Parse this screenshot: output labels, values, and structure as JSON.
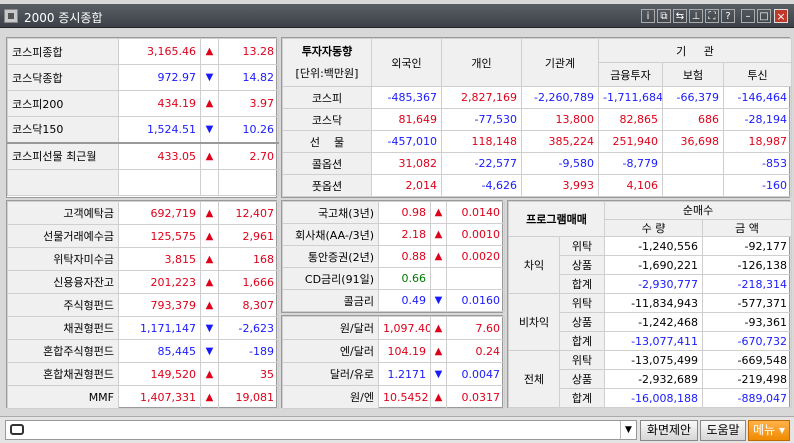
{
  "window": {
    "title": "2000 증시종합"
  },
  "index": [
    {
      "name": "코스피종합",
      "value": "3,165.46",
      "dir": "up",
      "change": "13.28"
    },
    {
      "name": "코스닥종합",
      "value": "972.97",
      "dir": "down",
      "change": "14.82"
    },
    {
      "name": "코스피200",
      "value": "434.19",
      "dir": "up",
      "change": "3.97"
    },
    {
      "name": "코스닥150",
      "value": "1,524.51",
      "dir": "down",
      "change": "10.26"
    }
  ],
  "futures": {
    "name": "코스피선물 최근월",
    "value": "433.05",
    "dir": "up",
    "change": "2.70"
  },
  "investor": {
    "title": "투자자동향",
    "unit": "[단위:백만원]",
    "cols": [
      "외국인",
      "개인",
      "기관계"
    ],
    "inst_title": "기     관",
    "inst_cols": [
      "금융투자",
      "보험",
      "투신"
    ],
    "rows": [
      {
        "label": "코스피",
        "vals": [
          "-485,367",
          "2,827,169",
          "-2,260,789",
          "-1,711,684",
          "-66,379",
          "-146,464"
        ]
      },
      {
        "label": "코스닥",
        "vals": [
          "81,649",
          "-77,530",
          "13,800",
          "82,865",
          "686",
          "-28,194"
        ]
      },
      {
        "label": "선    물",
        "vals": [
          "-457,010",
          "118,148",
          "385,224",
          "251,940",
          "36,698",
          "18,987"
        ]
      },
      {
        "label": "콜옵션",
        "vals": [
          "31,082",
          "-22,577",
          "-9,580",
          "-8,779",
          "",
          "-853"
        ]
      },
      {
        "label": "풋옵션",
        "vals": [
          "2,014",
          "-4,626",
          "3,993",
          "4,106",
          "",
          "-160"
        ]
      }
    ]
  },
  "funds": [
    {
      "name": "고객예탁금",
      "value": "692,719",
      "dir": "up",
      "change": "12,407"
    },
    {
      "name": "선물거래예수금",
      "value": "125,575",
      "dir": "up",
      "change": "2,961"
    },
    {
      "name": "위탁자미수금",
      "value": "3,815",
      "dir": "up",
      "change": "168"
    },
    {
      "name": "신용융자잔고",
      "value": "201,223",
      "dir": "up",
      "change": "1,666"
    },
    {
      "name": "주식형펀드",
      "value": "793,379",
      "dir": "up",
      "change": "8,307"
    },
    {
      "name": "채권형펀드",
      "value": "1,171,147",
      "dir": "down",
      "change": "-2,623"
    },
    {
      "name": "혼합주식형펀드",
      "value": "85,445",
      "dir": "down",
      "change": "-189"
    },
    {
      "name": "혼합채권형펀드",
      "value": "149,520",
      "dir": "up",
      "change": "35"
    },
    {
      "name": "MMF",
      "value": "1,407,331",
      "dir": "up",
      "change": "19,081"
    }
  ],
  "rates": [
    {
      "name": "국고채(3년)",
      "value": "0.98",
      "color": "red",
      "dir": "up",
      "change": "0.0140"
    },
    {
      "name": "회사채(AA-/3년)",
      "value": "2.18",
      "color": "red",
      "dir": "up",
      "change": "0.0010"
    },
    {
      "name": "통안증권(2년)",
      "value": "0.88",
      "color": "red",
      "dir": "up",
      "change": "0.0020"
    },
    {
      "name": "CD금리(91일)",
      "value": "0.66",
      "color": "green",
      "dir": "",
      "change": ""
    },
    {
      "name": "콜금리",
      "value": "0.49",
      "color": "blue",
      "dir": "down",
      "change": "0.0160"
    }
  ],
  "fx": [
    {
      "name": "원/달러",
      "value": "1,097.40",
      "color": "red",
      "dir": "up",
      "change": "7.60"
    },
    {
      "name": "엔/달러",
      "value": "104.19",
      "color": "red",
      "dir": "up",
      "change": "0.24"
    },
    {
      "name": "달러/유로",
      "value": "1.2171",
      "color": "blue",
      "dir": "down",
      "change": "0.0047"
    },
    {
      "name": "원/엔",
      "value": "10.5452",
      "color": "red",
      "dir": "up",
      "change": "0.0317"
    }
  ],
  "program": {
    "title": "프로그램매매",
    "net_title": "순매수",
    "qty_label": "수  량",
    "amt_label": "금  액",
    "groups": [
      {
        "name": "차익",
        "rows": [
          {
            "type": "위탁",
            "qty": "-1,240,556",
            "amt": "-92,177",
            "color": "black"
          },
          {
            "type": "상품",
            "qty": "-1,690,221",
            "amt": "-126,138",
            "color": "black"
          },
          {
            "type": "합계",
            "qty": "-2,930,777",
            "amt": "-218,314",
            "color": "blue"
          }
        ]
      },
      {
        "name": "비차익",
        "rows": [
          {
            "type": "위탁",
            "qty": "-11,834,943",
            "amt": "-577,371",
            "color": "black"
          },
          {
            "type": "상품",
            "qty": "-1,242,468",
            "amt": "-93,361",
            "color": "black"
          },
          {
            "type": "합계",
            "qty": "-13,077,411",
            "amt": "-670,732",
            "color": "blue"
          }
        ]
      },
      {
        "name": "전체",
        "rows": [
          {
            "type": "위탁",
            "qty": "-13,075,499",
            "amt": "-669,548",
            "color": "black"
          },
          {
            "type": "상품",
            "qty": "-2,932,689",
            "amt": "-219,498",
            "color": "black"
          },
          {
            "type": "합계",
            "qty": "-16,008,188",
            "amt": "-889,047",
            "color": "blue"
          }
        ]
      }
    ]
  },
  "bottom": {
    "btn1": "화면제안",
    "btn2": "도움말",
    "btn3": "메뉴"
  }
}
